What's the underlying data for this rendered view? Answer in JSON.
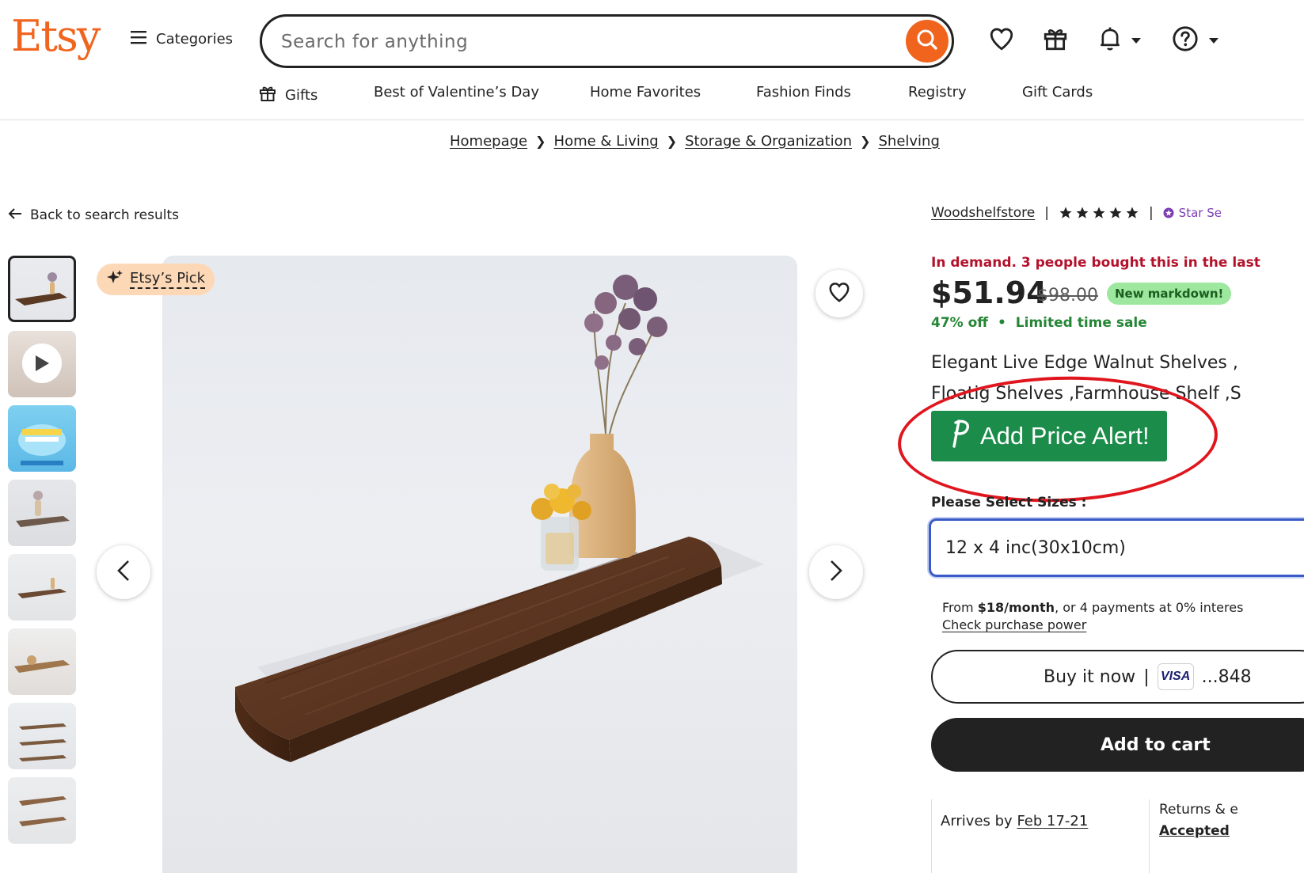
{
  "header": {
    "logo": "Etsy",
    "categories_label": "Categories",
    "search_placeholder": "Search for anything",
    "icons": [
      "favorites-icon",
      "gift-icon",
      "bell-icon",
      "help-icon"
    ]
  },
  "nav": {
    "items": [
      {
        "label": "Gifts"
      },
      {
        "label": "Best of Valentine’s Day"
      },
      {
        "label": "Home Favorites"
      },
      {
        "label": "Fashion Finds"
      },
      {
        "label": "Registry"
      },
      {
        "label": "Gift Cards"
      }
    ]
  },
  "breadcrumb": [
    "Homepage",
    "Home & Living",
    "Storage & Organization",
    "Shelving"
  ],
  "back_label": "Back to search results",
  "gallery": {
    "badge": "Etsy’s Pick",
    "thumb_count": 8
  },
  "shop": {
    "name": "Woodshelfstore",
    "rating_stars": 5,
    "star_seller": "Star Se"
  },
  "product": {
    "demand": "In demand. 3 people bought this in the last",
    "price": "$51.94",
    "original_price": "$98.00",
    "markdown_badge": "New markdown!",
    "discount": "47% off",
    "sale_note": "Limited time sale",
    "title_line1": "Elegant Live Edge Walnut Shelves ,",
    "title_line2": "Floatig Shelves ,Farmhouse Shelf ,S"
  },
  "price_alert": {
    "label": "Add Price Alert!"
  },
  "options": {
    "size_label": "Please Select Sizes :",
    "size_value": "12 x 4 inc(30x10cm)"
  },
  "payment": {
    "from_prefix": "From ",
    "monthly": "$18/month",
    "suffix": ", or 4 payments at 0% interes",
    "check_power": "Check purchase power",
    "buy_now": "Buy it now",
    "card_brand": "VISA",
    "card_last": "...848",
    "add_to_cart": "Add to cart"
  },
  "delivery": {
    "arrives_prefix": "Arrives by",
    "arrives_date": "Feb 17-21",
    "returns": "Returns & e",
    "returns_sub": "Accepted"
  },
  "colors": {
    "brand": "#f1641e",
    "price_alert_green": "#1c8c4a",
    "demand_red": "#b3122b",
    "discount_green": "#258635",
    "annotation_red": "#e0161e"
  }
}
